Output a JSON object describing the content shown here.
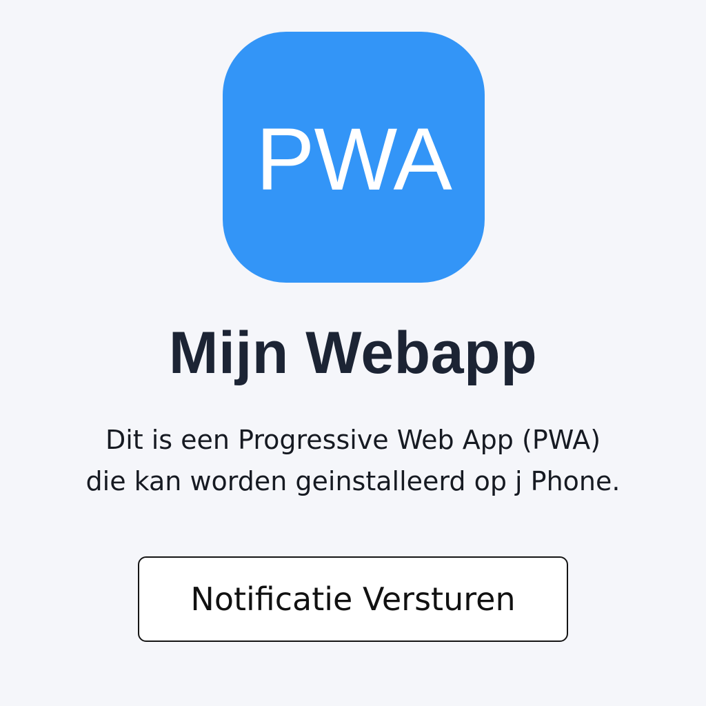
{
  "app_icon": {
    "label": "PWA",
    "color": "#3395f7"
  },
  "page": {
    "title": "Mijn Webapp",
    "description_lines": [
      "Dit is een Progressive Web App (PWA)",
      "die kan worden geinstalleerd op j Phone."
    ]
  },
  "actions": {
    "notify_label": "Notificatie Versturen"
  },
  "colors": {
    "background": "#f5f6fa",
    "title_text": "#1c2434",
    "button_border": "#141414"
  }
}
